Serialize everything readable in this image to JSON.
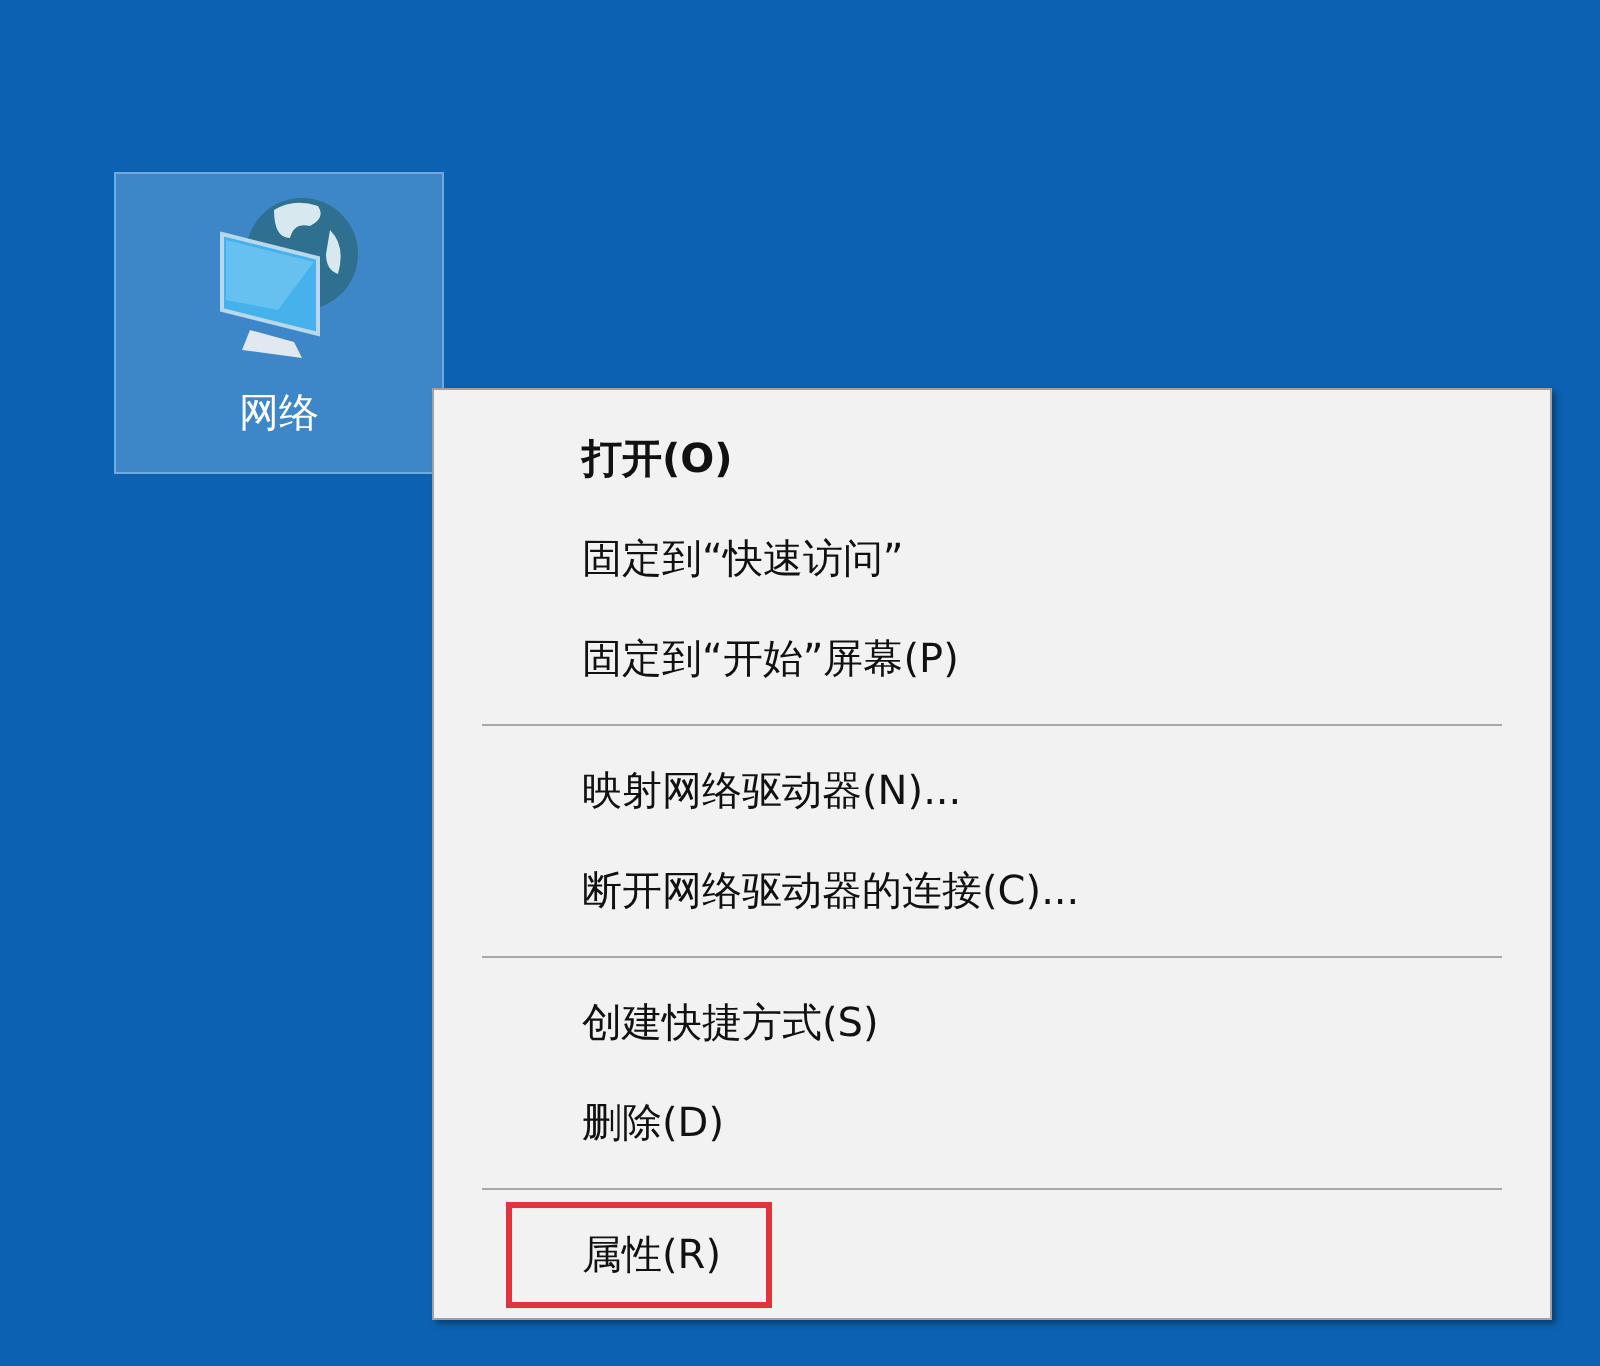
{
  "desktop_icons": [
    {
      "label": "网络",
      "selected": true
    }
  ],
  "context_menu": {
    "items": [
      {
        "kind": "item",
        "label": "打开(O)",
        "default": true,
        "highlighted": false
      },
      {
        "kind": "item",
        "label": "固定到“快速访问”",
        "default": false,
        "highlighted": false
      },
      {
        "kind": "item",
        "label": "固定到“开始”屏幕(P)",
        "default": false,
        "highlighted": false
      },
      {
        "kind": "separator"
      },
      {
        "kind": "item",
        "label": "映射网络驱动器(N)...",
        "default": false,
        "highlighted": false
      },
      {
        "kind": "item",
        "label": "断开网络驱动器的连接(C)...",
        "default": false,
        "highlighted": false
      },
      {
        "kind": "separator"
      },
      {
        "kind": "item",
        "label": "创建快捷方式(S)",
        "default": false,
        "highlighted": false
      },
      {
        "kind": "item",
        "label": "删除(D)",
        "default": false,
        "highlighted": false
      },
      {
        "kind": "separator"
      },
      {
        "kind": "item",
        "label": "属性(R)",
        "default": false,
        "highlighted": true
      }
    ]
  }
}
